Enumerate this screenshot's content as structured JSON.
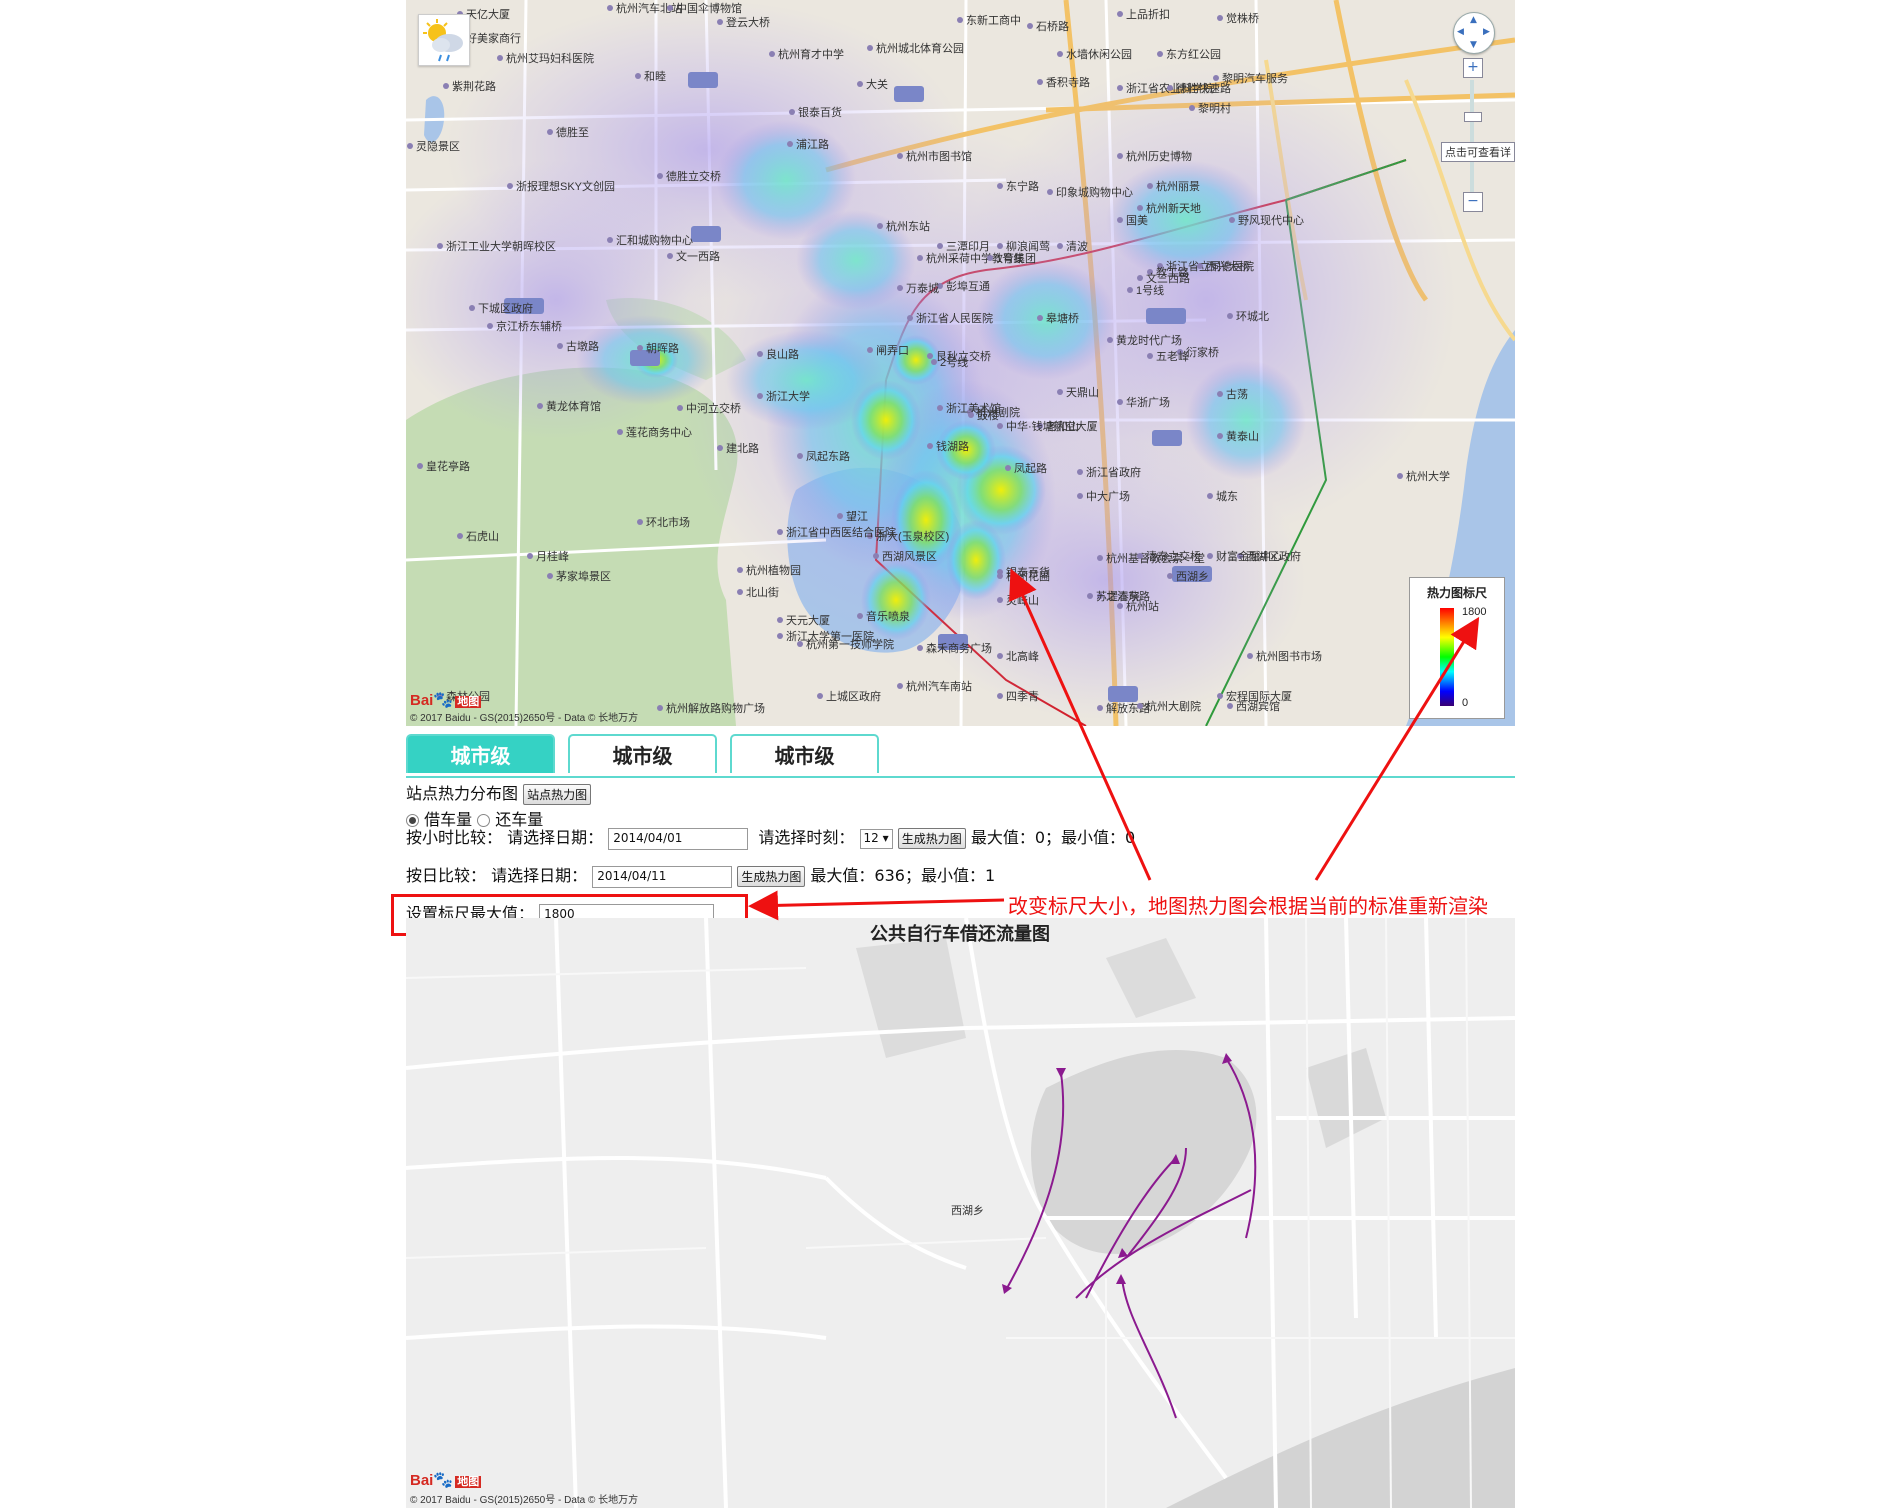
{
  "heatmap": {
    "copyright": "© 2017 Baidu - GS(2015)2650号 - Data © 长地万方",
    "baidu_logo_bai": "Bai",
    "baidu_logo_du": "du",
    "baidu_logo_ditu": "地图",
    "zoom_tip": "点击可查看详",
    "zoom_in": "+",
    "zoom_out": "−",
    "labels": [
      "天亿大厦",
      "杭州汽车北站",
      "中国伞博物馆",
      "登云大桥",
      "东新工商中",
      "上品折扣",
      "觉株桥",
      "好美家商行",
      "杭州艾玛妇科医院",
      "紫荆花路",
      "和睦",
      "杭州育才中学",
      "杭州城北体育公园",
      "石桥路",
      "水墙休闲公园",
      "东方红公园",
      "黎明汽车服务",
      "大关",
      "香积寺路",
      "浙江省农业科学院",
      "德胜快速路",
      "黎明村",
      "德胜至",
      "银泰百货",
      "浦江路",
      "杭州市图书馆",
      "杭州历史博物",
      "浙报理想SKY文创园",
      "德胜立交桥",
      "东宁路",
      "印象城购物中心",
      "杭州丽景",
      "杭州新天地",
      "浙江工业大学朝晖校区",
      "汇和城购物中心",
      "杭州东站",
      "文一西路",
      "国美",
      "浙江省立同德医院",
      "野风现代中心",
      "杭州采荷中学教育集团",
      "彭埠互通",
      "教工路",
      "浙江省人民医院",
      "1号线",
      "下城区政府",
      "京江桥东辅桥",
      "古墩路",
      "朝晖路",
      "闸弄口",
      "皋塘桥",
      "文三西路",
      "环城北",
      "良山路",
      "艮秋立交桥",
      "衍家桥",
      "古荡",
      "黄龙时代广场",
      "浙江大学",
      "华浙广场",
      "中河立交桥",
      "建北路",
      "杭州大学",
      "皇花亭路",
      "莲花商务中心",
      "黄龙体育馆",
      "杭州剧院",
      "浙江省政府",
      "中大广场",
      "城东",
      "钱湖路",
      "凤起东路",
      "老和山",
      "浙大(玉泉校区)",
      "环北市场",
      "浙江省中西医结合医院",
      "黄泰山",
      "石虎山",
      "西湖区政府",
      "银泰百货",
      "杭州基督教会崇一堂",
      "之江东路",
      "灵峰山",
      "杭州植物园",
      "北山街",
      "浙江大学第一医院",
      "森禾商务广场",
      "天元大厦",
      "杭州第一技师学院",
      "音乐喷泉",
      "西湖风景区",
      "杭州图书市场",
      "宏程国际大厦",
      "森林公园",
      "杭州解放路购物广场",
      "解放东路",
      "杭州大剧院",
      "北高峰",
      "杭州花圃",
      "清泰立交桥",
      "四季青",
      "杭州站",
      "财富金融中心",
      "西湖乡",
      "苏堤春晓",
      "上城区政府",
      "灵隐景区",
      "茅家埠景区",
      "中华·钱塘航空大厦",
      "月桂峰",
      "三潭印月",
      "柳浪闻莺",
      "清波",
      "杭州汽车南站",
      "西湖宾馆",
      "望江",
      "西兴大桥",
      "天鼎山",
      "五老峰",
      "浙江美术馆",
      "万泰城",
      "1号线",
      "2号线",
      "鼓楼",
      "凤起路"
    ],
    "legend": {
      "title": "热力图标尺",
      "max": "1800",
      "min": "0"
    },
    "colors": {
      "accent": "#35d2c4",
      "annotation": "#ee1111"
    }
  },
  "tabs": [
    {
      "label": "城市级",
      "active": true
    },
    {
      "label": "城市级",
      "active": false
    },
    {
      "label": "城市级",
      "active": false
    }
  ],
  "controls": {
    "station_heat_label": "站点热力分布图",
    "station_heat_button": "站点热力图",
    "radio_borrow": "借车量",
    "radio_return": "还车量",
    "hourly_label": "按小时比较：",
    "choose_date": "请选择日期：",
    "hourly_date": "2014/04/01",
    "choose_hour": "请选择时刻：",
    "hour_value": "12",
    "gen_button": "生成热力图",
    "hourly_max": "最大值：0；最小值：0",
    "daily_label": "按日比较：",
    "daily_date": "2014/04/11",
    "daily_max": "最大值：636；最小值：1",
    "scale_label": "设置标尺最大值：",
    "scale_value": "1800"
  },
  "annotation": "改变标尺大小，地图热力图会根据当前的标准重新渲染",
  "flowmap": {
    "title": "公共自行车借还流量图",
    "label_xihu": "西湖乡",
    "copyright": "© 2017 Baidu - GS(2015)2650号 - Data © 长地万方",
    "baidu_logo_bai": "Bai",
    "baidu_logo_du": "du",
    "baidu_logo_ditu": "地图",
    "flow_color": "#8b1a8f"
  }
}
